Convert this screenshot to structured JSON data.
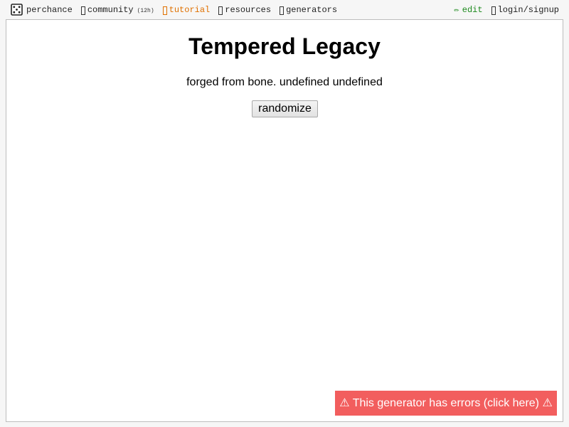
{
  "nav": {
    "brand_label": "perchance",
    "community_label": "community",
    "community_badge": "(12h)",
    "tutorial_label": "tutorial",
    "resources_label": "resources",
    "generators_label": "generators",
    "edit_icon": "✏",
    "edit_label": "edit",
    "login_label": "login/signup"
  },
  "colors": {
    "tutorial": "#e07000",
    "edit": "#1d8a1d",
    "error_banner": "#f25e5e"
  },
  "main": {
    "title": "Tempered Legacy",
    "output": "forged from bone. undefined undefined",
    "randomize_label": "randomize"
  },
  "error": {
    "message": "⚠ This generator has errors (click here) ⚠"
  }
}
